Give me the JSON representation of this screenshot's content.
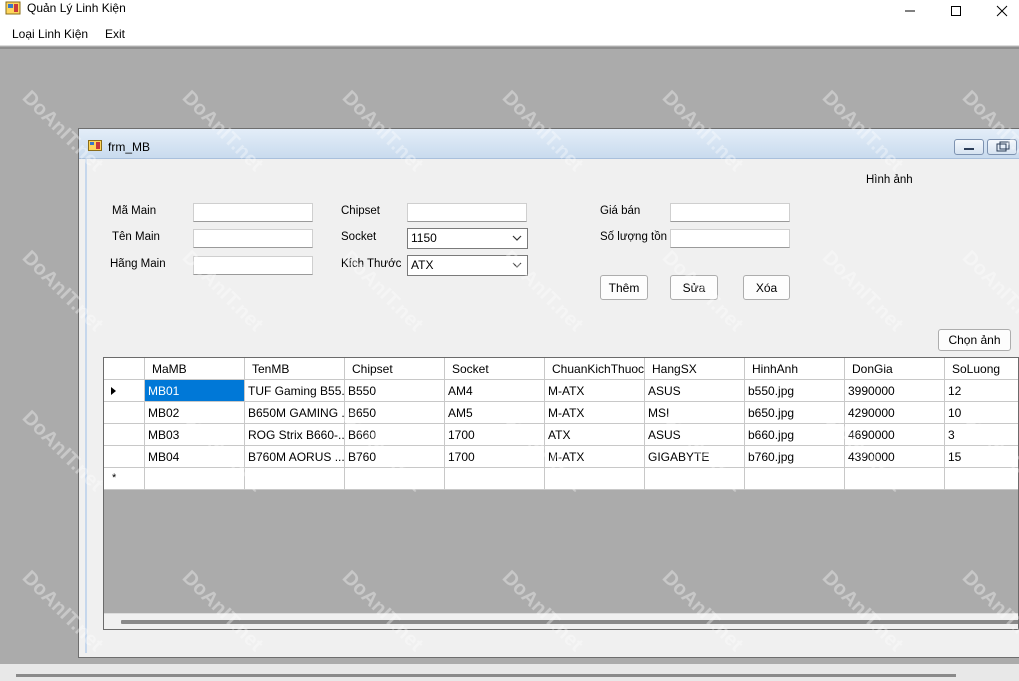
{
  "app": {
    "title": "Quản Lý Linh Kiện",
    "menu": [
      "Loại Linh Kiện",
      "Exit"
    ]
  },
  "form": {
    "title": "frm_MB",
    "image_label": "Hình ảnh",
    "fields": {
      "ma_main_label": "Mã Main",
      "ten_main_label": "Tên Main",
      "hang_main_label": "Hãng Main",
      "chipset_label": "Chipset",
      "socket_label": "Socket",
      "kich_thuoc_label": "Kích Thước",
      "gia_ban_label": "Giá bán",
      "so_luong_label": "Số lượng tồn",
      "ma_main_value": "",
      "ten_main_value": "",
      "hang_main_value": "",
      "chipset_value": "",
      "socket_value": "1150",
      "kich_thuoc_value": "ATX",
      "gia_ban_value": "",
      "so_luong_value": ""
    },
    "buttons": {
      "them": "Thêm",
      "sua": "Sửa",
      "xoa": "Xóa",
      "chon_anh": "Chọn ảnh"
    }
  },
  "grid": {
    "columns": [
      "MaMB",
      "TenMB",
      "Chipset",
      "Socket",
      "ChuanKichThuoc",
      "HangSX",
      "HinhAnh",
      "DonGia",
      "SoLuong"
    ],
    "rows": [
      [
        "MB01",
        "TUF Gaming B55...",
        "B550",
        "AM4",
        "M-ATX",
        "ASUS",
        "b550.jpg",
        "3990000",
        "12"
      ],
      [
        "MB02",
        "B650M GAMING ...",
        "B650",
        "AM5",
        "M-ATX",
        "MSI",
        "b650.jpg",
        "4290000",
        "10"
      ],
      [
        "MB03",
        "ROG Strix B660-...",
        "B660",
        "1700",
        "ATX",
        "ASUS",
        "b660.jpg",
        "4690000",
        "3"
      ],
      [
        "MB04",
        "B760M AORUS ...",
        "B760",
        "1700",
        "M-ATX",
        "GIGABYTE",
        "b760.jpg",
        "4390000",
        "15"
      ]
    ]
  },
  "watermark": "DoAnIT.net"
}
